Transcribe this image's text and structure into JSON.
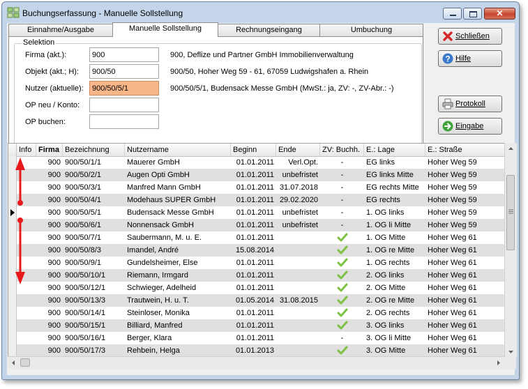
{
  "window": {
    "title": "Buchungserfassung - Manuelle Sollstellung",
    "close_glyph": "✕"
  },
  "tabs": [
    {
      "label": "Einnahme/Ausgabe",
      "active": false
    },
    {
      "label": "Manuelle Sollstellung",
      "active": true
    },
    {
      "label": "Rechnungseingang",
      "active": false
    },
    {
      "label": "Umbuchung",
      "active": false
    }
  ],
  "selection": {
    "legend": "Selektion",
    "fields": [
      {
        "label": "Firma (akt.):",
        "value": "900",
        "description": "900,  Deflize und Partner GmbH Immobilienverwaltung"
      },
      {
        "label": "Objekt (akt.; H):",
        "value": "900/50",
        "description": "900/50,  Hoher Weg 59 - 61, 67059 Ludwigshafen a. Rhein"
      },
      {
        "label": "Nutzer (aktuelle):",
        "value": "900/50/5/1",
        "description": "900/50/5/1,  Budensack Messe GmbH  (MwSt.: ja,  ZV: -, ZV-Abr.: -)"
      },
      {
        "label": "OP neu / Konto:",
        "value": "",
        "description": ""
      },
      {
        "label": "OP buchen:",
        "value": "",
        "description": ""
      }
    ]
  },
  "buttons": {
    "close": "Schließen",
    "help": "Hilfe",
    "protocol": "Protokoll",
    "entry": "Eingabe"
  },
  "colors": {
    "accent_highlight": "#f9b789",
    "arrow": "#e8191b",
    "check": "#7cc142",
    "row_alt": "#e0e0e0"
  },
  "grid": {
    "columns": [
      "Info",
      "Firma",
      "Bezeichnung",
      "Nutzername",
      "Beginn",
      "Ende",
      "ZV: Buchh.",
      "E.: Lage",
      "E.: Straße"
    ],
    "rows": [
      {
        "firma": "900",
        "bez": "900/50/1/1",
        "name": "Mauerer GmbH",
        "beginn": "01.01.2011",
        "ende": "Verl.Opt.",
        "zv": "-",
        "lage": "EG links",
        "strasse": "Hoher Weg 59"
      },
      {
        "firma": "900",
        "bez": "900/50/2/1",
        "name": "Augen Opti GmbH",
        "beginn": "01.01.2011",
        "ende": "unbefristet",
        "zv": "-",
        "lage": "EG links Mitte",
        "strasse": "Hoher Weg 59"
      },
      {
        "firma": "900",
        "bez": "900/50/3/1",
        "name": "Manfred Mann GmbH",
        "beginn": "01.01.2011",
        "ende": "31.07.2018",
        "zv": "-",
        "lage": "EG rechts Mitte",
        "strasse": "Hoher Weg 59"
      },
      {
        "firma": "900",
        "bez": "900/50/4/1",
        "name": "Modehaus SUPER GmbH",
        "beginn": "01.01.2011",
        "ende": "29.02.2020",
        "zv": "-",
        "lage": "EG rechts",
        "strasse": "Hoher Weg 59"
      },
      {
        "firma": "900",
        "bez": "900/50/5/1",
        "name": "Budensack Messe GmbH",
        "beginn": "01.01.2011",
        "ende": "unbefristet",
        "zv": "-",
        "lage": "1. OG links",
        "strasse": "Hoher Weg 59"
      },
      {
        "firma": "900",
        "bez": "900/50/6/1",
        "name": "Nonnensack GmbH",
        "beginn": "01.01.2011",
        "ende": "unbefristet",
        "zv": "-",
        "lage": "1. OG li Mitte",
        "strasse": "Hoher Weg 59"
      },
      {
        "firma": "900",
        "bez": "900/50/7/1",
        "name": "Saubermann, M. u. E.",
        "beginn": "01.01.2011",
        "ende": "",
        "zv": "check",
        "lage": "1. OG Mitte",
        "strasse": "Hoher Weg 61"
      },
      {
        "firma": "900",
        "bez": "900/50/8/3",
        "name": "Imandel, André",
        "beginn": "15.08.2014",
        "ende": "",
        "zv": "check",
        "lage": "1. OG re Mitte",
        "strasse": "Hoher Weg 61"
      },
      {
        "firma": "900",
        "bez": "900/50/9/1",
        "name": "Gundelsheimer, Else",
        "beginn": "01.01.2011",
        "ende": "",
        "zv": "check",
        "lage": "1. OG rechts",
        "strasse": "Hoher Weg 61"
      },
      {
        "firma": "900",
        "bez": "900/50/10/1",
        "name": "Riemann, Irmgard",
        "beginn": "01.01.2011",
        "ende": "",
        "zv": "check",
        "lage": "2. OG links",
        "strasse": "Hoher Weg 61"
      },
      {
        "firma": "900",
        "bez": "900/50/12/1",
        "name": "Schwieger, Adelheid",
        "beginn": "01.01.2011",
        "ende": "",
        "zv": "check",
        "lage": "2. OG Mitte",
        "strasse": "Hoher Weg 61"
      },
      {
        "firma": "900",
        "bez": "900/50/13/3",
        "name": "Trautwein, H. u. T.",
        "beginn": "01.05.2014",
        "ende": "31.08.2015",
        "zv": "check",
        "lage": "2. OG re Mitte",
        "strasse": "Hoher Weg 61"
      },
      {
        "firma": "900",
        "bez": "900/50/14/1",
        "name": "Steinloser, Monika",
        "beginn": "01.01.2011",
        "ende": "",
        "zv": "check",
        "lage": "2. OG rechts",
        "strasse": "Hoher Weg 61"
      },
      {
        "firma": "900",
        "bez": "900/50/15/1",
        "name": "Billiard, Manfred",
        "beginn": "01.01.2011",
        "ende": "",
        "zv": "check",
        "lage": "3. OG links",
        "strasse": "Hoher Weg 61"
      },
      {
        "firma": "900",
        "bez": "900/50/16/1",
        "name": "Berger, Klara",
        "beginn": "01.01.2011",
        "ende": "",
        "zv": "-",
        "lage": "3. OG li Mitte",
        "strasse": "Hoher Weg 61"
      },
      {
        "firma": "900",
        "bez": "900/50/17/3",
        "name": "Rehbein, Helga",
        "beginn": "01.01.2013",
        "ende": "",
        "zv": "check",
        "lage": "3. OG Mitte",
        "strasse": "Hoher Weg 61"
      }
    ],
    "current_row": 4
  }
}
